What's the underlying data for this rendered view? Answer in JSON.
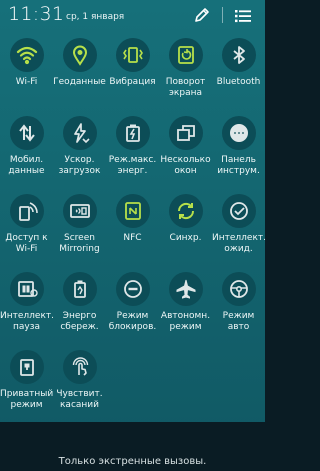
{
  "header": {
    "time": "11:31",
    "date": "ср, 1 января",
    "edit_icon": "pencil-icon",
    "list_icon": "list-icon"
  },
  "colors": {
    "active_icon": "#b7e04a",
    "inactive_icon": "#dfe7e8",
    "tile_circle": "#0c4d57",
    "background": "#146872"
  },
  "tiles": [
    {
      "label": "Wi-Fi",
      "icon": "wifi-icon",
      "active": true
    },
    {
      "label": "Геоданные",
      "icon": "location-pin-icon",
      "active": true
    },
    {
      "label": "Вибрация",
      "icon": "vibrate-icon",
      "active": true
    },
    {
      "label": "Поворот\nэкрана",
      "icon": "screen-rotation-icon",
      "active": true
    },
    {
      "label": "Bluetooth",
      "icon": "bluetooth-icon",
      "active": false
    },
    {
      "label": "Мобил.\nданные",
      "icon": "mobile-data-icon",
      "active": false
    },
    {
      "label": "Ускор.\nзагрузок",
      "icon": "download-booster-icon",
      "active": false
    },
    {
      "label": "Реж.макс.\nэнерг.",
      "icon": "ultra-power-saving-icon",
      "active": false
    },
    {
      "label": "Несколько\nокон",
      "icon": "multi-window-icon",
      "active": false
    },
    {
      "label": "Панель\nинструм.",
      "icon": "toolbox-icon",
      "active": false
    },
    {
      "label": "Доступ к\nWi-Fi",
      "icon": "wifi-hotspot-icon",
      "active": false
    },
    {
      "label": "Screen\nMirroring",
      "icon": "screen-mirroring-icon",
      "active": false
    },
    {
      "label": "NFC",
      "icon": "nfc-icon",
      "active": true
    },
    {
      "label": "Синхр.",
      "icon": "sync-icon",
      "active": true
    },
    {
      "label": "Интеллект.\nожид.",
      "icon": "smart-stay-icon",
      "active": false
    },
    {
      "label": "Интеллект.\nпауза",
      "icon": "smart-pause-icon",
      "active": false
    },
    {
      "label": "Энерго\nсбереж.",
      "icon": "power-saving-icon",
      "active": false
    },
    {
      "label": "Режим\nблокиров.",
      "icon": "blocking-mode-icon",
      "active": false
    },
    {
      "label": "Автономн.\nрежим",
      "icon": "airplane-icon",
      "active": false
    },
    {
      "label": "Режим\nавто",
      "icon": "car-mode-icon",
      "active": false
    },
    {
      "label": "Приватный\nрежим",
      "icon": "private-mode-icon",
      "active": false
    },
    {
      "label": "Чувствит.\nкасаний",
      "icon": "touch-sensitivity-icon",
      "active": false
    }
  ],
  "footer": {
    "status": "Только экстренные вызовы."
  }
}
